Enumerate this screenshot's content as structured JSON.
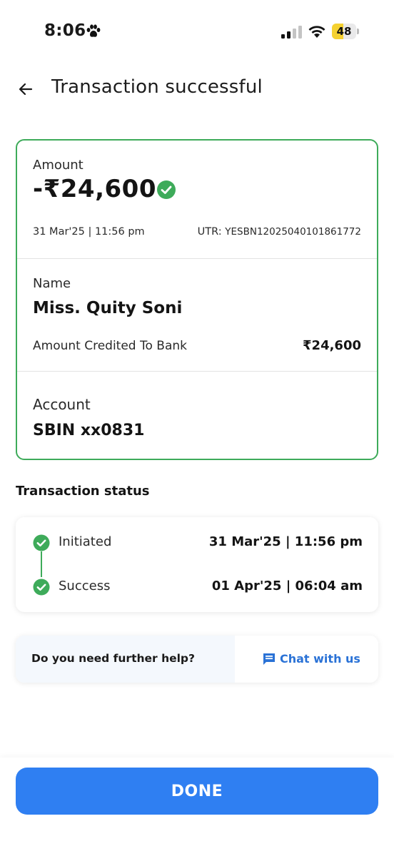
{
  "status_bar": {
    "time": "8:06",
    "battery": "48",
    "battery_level": 0.48,
    "icons": [
      "paw-icon",
      "signal-icon",
      "wifi-icon",
      "battery-icon"
    ]
  },
  "header": {
    "title": "Transaction successful",
    "back_icon": "arrow-left-icon"
  },
  "amount_section": {
    "label": "Amount",
    "value": "-₹24,600",
    "date": "31 Mar'25 | 11:56 pm",
    "utr_label": "UTR:",
    "utr_value": "YESBN12025040101861772"
  },
  "name_section": {
    "label": "Name",
    "value": "Miss. Quity Soni",
    "credited_label": "Amount Credited To Bank",
    "credited_value": "₹24,600"
  },
  "account_section": {
    "label": "Account",
    "value": "SBIN xx0831"
  },
  "transaction_status": {
    "heading": "Transaction status",
    "steps": [
      {
        "label": "Initiated",
        "time": "31 Mar'25 | 11:56 pm"
      },
      {
        "label": "Success",
        "time": "01 Apr'25 | 06:04 am"
      }
    ]
  },
  "help": {
    "question": "Do you need further help?",
    "chat_label": "Chat with us"
  },
  "footer": {
    "done_label": "DONE"
  },
  "colors": {
    "success_green": "#3eab5a",
    "primary_blue": "#2f7ff2",
    "link_blue": "#2a72d6",
    "battery_yellow": "#f5d130"
  }
}
